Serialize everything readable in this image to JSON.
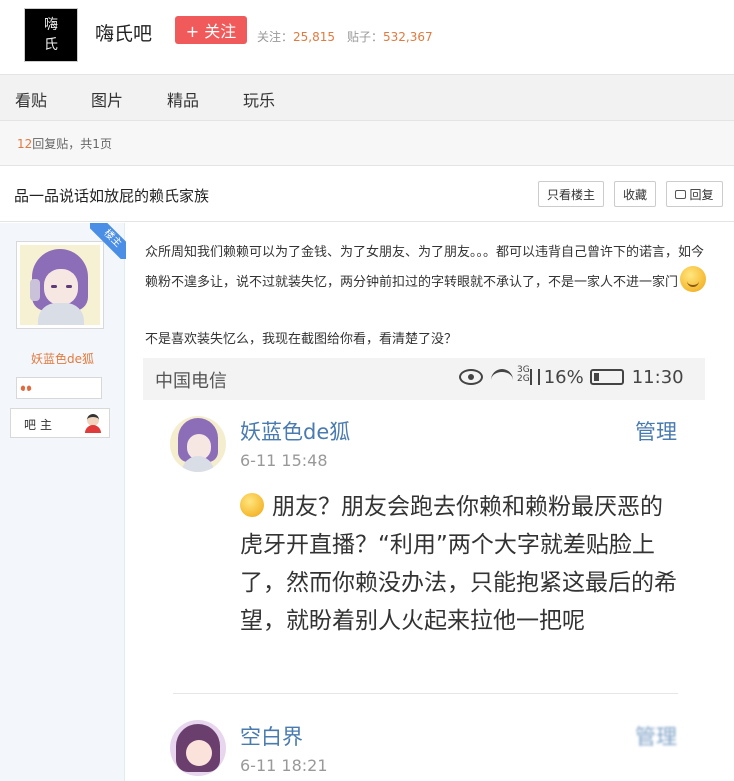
{
  "header": {
    "logo_chars": [
      "嗨",
      "氏"
    ],
    "forum_name": "嗨氏吧",
    "follow_label": "+ 关注",
    "follow_count_label": "关注：",
    "follow_count": "25,815",
    "posts_count_label": "贴子：",
    "posts_count": "532,367"
  },
  "nav": {
    "tabs": [
      {
        "label": "看贴"
      },
      {
        "label": "图片"
      },
      {
        "label": "精品"
      },
      {
        "label": "玩乐"
      }
    ]
  },
  "thread_info": {
    "reply_count": "12",
    "reply_text": "回复贴，共",
    "pages": "1",
    "pages_suffix": "页"
  },
  "thread": {
    "title": "品一品说话如放屁的赖氏家族",
    "only_op_label": "只看楼主",
    "favorite_label": "收藏",
    "reply_label": "回复",
    "reply_icon": "speech-bubble-icon"
  },
  "post": {
    "badge": "楼主",
    "username": "妖蓝色de狐",
    "level_icon": "lungs-icon",
    "role_label": "吧主",
    "role_icon": "moderator-avatar-icon",
    "paragraph1": "众所周知我们赖赖可以为了金钱、为了女朋友、为了朋友。。。都可以违背自己曾许下的诺言，如今赖粉不遑多让，说不过就装失忆，两分钟前扣过的字转眼就不承认了，不是一家人不进一家门",
    "paragraph2": "不是喜欢装失忆么，我现在截图给你看，看清楚了没？"
  },
  "screenshot": {
    "carrier": "中国电信",
    "network_top": "3G",
    "network_bottom": "2G",
    "battery": "16%",
    "time": "11:30",
    "comments": [
      {
        "user": "妖蓝色de狐",
        "time": "6-11 15:48",
        "action": "管理",
        "text": "朋友？朋友会跑去你赖和赖粉最厌恶的虎牙开直播？“利用”两个大字就差贴脸上了，然而你赖没办法，只能抱紧这最后的希望，就盼着别人火起来拉他一把呢"
      },
      {
        "user": "空白界",
        "time": "6-11 18:21",
        "action": "管理"
      }
    ]
  },
  "colors": {
    "accent_orange": "#e27a3f",
    "follow_red": "#f05a5a",
    "link_blue": "#4a7bb0",
    "badge_blue": "#4a8ee6"
  }
}
